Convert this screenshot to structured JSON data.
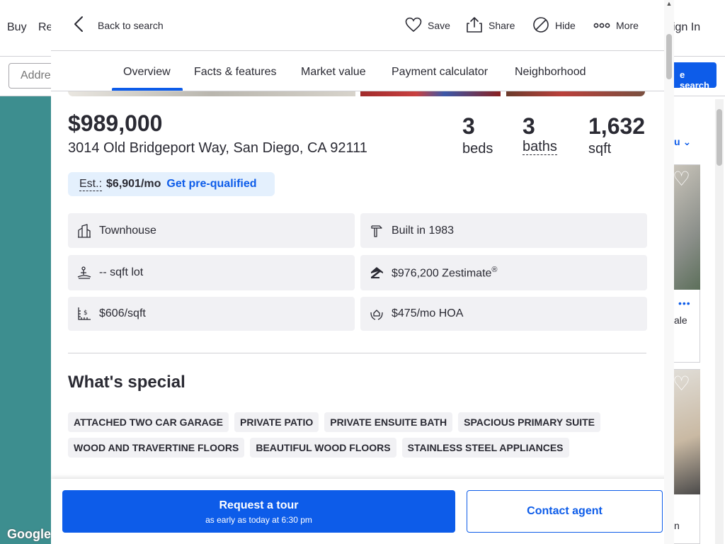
{
  "background": {
    "nav": {
      "buy": "Buy",
      "rent": "Re",
      "sign_in": "ign In"
    },
    "search": {
      "placeholder": "Addre",
      "save_search": "e search"
    },
    "sort": "u",
    "map_credit": "Google",
    "card1": {
      "status": "ale"
    },
    "card2": {
      "text": "n"
    }
  },
  "header": {
    "back": "Back to search",
    "actions": {
      "save": "Save",
      "share": "Share",
      "hide": "Hide",
      "more": "More"
    }
  },
  "tabs": [
    "Overview",
    "Facts & features",
    "Market value",
    "Payment calculator",
    "Neighborhood"
  ],
  "listing": {
    "price": "$989,000",
    "address": "3014 Old Bridgeport Way, San Diego, CA 92111",
    "beds": {
      "value": "3",
      "label": "beds"
    },
    "baths": {
      "value": "3",
      "label": "baths"
    },
    "sqft": {
      "value": "1,632",
      "label": "sqft"
    },
    "estimate": {
      "label": "Est.:",
      "amount": "$6,901/mo",
      "cta": "Get pre-qualified"
    }
  },
  "facts": {
    "type": "Townhouse",
    "built": "Built in 1983",
    "lot": "-- sqft lot",
    "zestimate": "$976,200 Zestimate",
    "zestimate_mark": "®",
    "price_per_sqft": "$606/sqft",
    "hoa": "$475/mo HOA"
  },
  "special": {
    "title": "What's special",
    "chips": [
      "ATTACHED TWO CAR GARAGE",
      "PRIVATE PATIO",
      "PRIVATE ENSUITE BATH",
      "SPACIOUS PRIMARY SUITE",
      "WOOD AND TRAVERTINE FLOORS",
      "BEAUTIFUL WOOD FLOORS",
      "STAINLESS STEEL APPLIANCES"
    ]
  },
  "footer": {
    "tour": "Request a tour",
    "tour_sub": "as early as today at 6:30 pm",
    "contact": "Contact agent"
  },
  "colors": {
    "accent": "#0d5ce9",
    "text": "#2a2a33",
    "chip_bg": "#f1f1f4",
    "estimate_bg": "#e4f0fd"
  }
}
